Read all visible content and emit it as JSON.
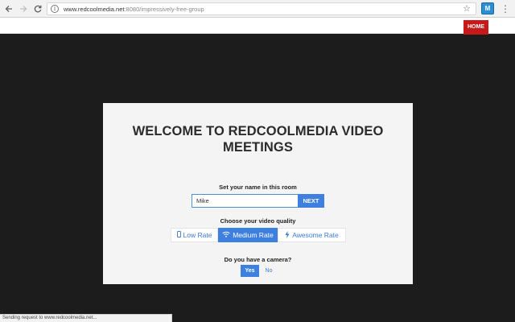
{
  "browser": {
    "url_host": "www.redcoolmedia.net",
    "url_rest": ":8080/impressively-free-group",
    "extension_icon": "extension-icon"
  },
  "header": {
    "home_label": "HOME"
  },
  "modal": {
    "title": "WELCOME TO REDCOOLMEDIA VIDEO MEETINGS",
    "name_label": "Set your name in this room",
    "name_value": "Mike",
    "next_label": "NEXT",
    "quality_label": "Choose your video quality",
    "quality_options": [
      {
        "label": "Low Rate",
        "icon": "phone-icon",
        "selected": false
      },
      {
        "label": "Medium Rate",
        "icon": "wifi-icon",
        "selected": true
      },
      {
        "label": "Awesome Rate",
        "icon": "bolt-icon",
        "selected": false
      }
    ],
    "camera_label": "Do you have a camera?",
    "yes_label": "Yes",
    "no_label": "No"
  },
  "status": {
    "text": "Sending request to www.redcoolmedia.net..."
  },
  "colors": {
    "accent": "#3d80e0",
    "home": "#c8191a",
    "background": "#1c1c1c"
  }
}
